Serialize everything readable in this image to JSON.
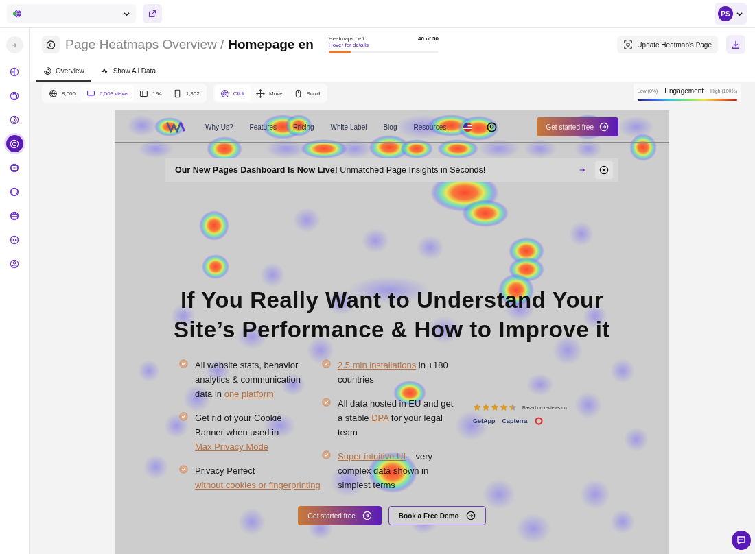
{
  "top_bar": {
    "avatar": "PS"
  },
  "sidebar": {
    "items": [
      {
        "selected": false
      },
      {
        "selected": false
      },
      {
        "selected": false
      },
      {
        "selected": false
      },
      {
        "selected": true
      },
      {
        "selected": false
      },
      {
        "selected": false
      },
      {
        "selected": false
      },
      {
        "selected": false
      },
      {
        "selected": false
      }
    ]
  },
  "header": {
    "breadcrumb": "Page Heatmaps Overview /",
    "title": "Homepage en",
    "quota": {
      "label": "Heatmaps Left",
      "hint": "Hover for details",
      "count": "40 of 50",
      "level": 0.2
    },
    "update_button": "Update Heatmap's Page"
  },
  "tabs": [
    {
      "label": "Overview",
      "selected": true,
      "kind": "overview"
    },
    {
      "label": "Show All Data",
      "selected": false,
      "kind": "data"
    }
  ],
  "device_filters": [
    {
      "kind": "all",
      "label": "8,000",
      "selected": false
    },
    {
      "kind": "desktop",
      "label": "6,503 views",
      "selected": true
    },
    {
      "kind": "tablet",
      "label": "194",
      "selected": false
    },
    {
      "kind": "mobile",
      "label": "1,302",
      "selected": false
    }
  ],
  "mode_filters": [
    {
      "kind": "click",
      "label": "Click",
      "selected": true
    },
    {
      "kind": "move",
      "label": "Move",
      "selected": false
    },
    {
      "kind": "scroll",
      "label": "Scroll",
      "selected": false
    }
  ],
  "legend": {
    "low": "Low (0%)",
    "title": "Engagement",
    "high": "High (100%)"
  },
  "preview": {
    "nav": {
      "items": [
        "Why Us?",
        "Features",
        "Pricing",
        "White Label",
        "Blog",
        "Resources"
      ],
      "cta": "Get started free"
    },
    "banner": "**Our New Pages Dashboard Is Now Live!** Unmatched Page Insights in Seconds!",
    "headline": "If You Really Want to Understand Your Site’s Performance & How to Improve it",
    "bullet_columns": [
      [
        {
          "parts": [
            {
              "text": "All website stats, behavior analytics & communication data in ",
              "link": false
            },
            {
              "text": "one platform",
              "link": true
            }
          ]
        },
        {
          "parts": [
            {
              "text": "Get rid of your Cookie Banner when used in ",
              "link": false
            },
            {
              "text": "Max Privacy Mode",
              "link": true
            }
          ]
        },
        {
          "parts": [
            {
              "text": "Privacy Perfect ",
              "link": false
            },
            {
              "text": "without cookies or fingerprinting",
              "link": true
            }
          ]
        }
      ],
      [
        {
          "parts": [
            {
              "text": "2.5 mln installations",
              "link": true
            },
            {
              "text": " in +180 countries",
              "link": false
            }
          ]
        },
        {
          "parts": [
            {
              "text": "All data hosted in EU and get a stable ",
              "link": false
            },
            {
              "text": "DPA",
              "link": true
            },
            {
              "text": " for your legal team",
              "link": false
            }
          ]
        },
        {
          "parts": [
            {
              "text": "Super intuitive UI",
              "link": true
            },
            {
              "text": " – very complex data shown in simplest terms",
              "link": false
            }
          ]
        }
      ]
    ],
    "rating": {
      "stars": 4.5,
      "caption": "Based on reviews on",
      "platforms": [
        "GetApp",
        "Capterra"
      ]
    },
    "buttons": [
      {
        "label": "Get started free",
        "kind": "primary"
      },
      {
        "label": "Book a Free Demo",
        "kind": "secondary"
      }
    ]
  }
}
